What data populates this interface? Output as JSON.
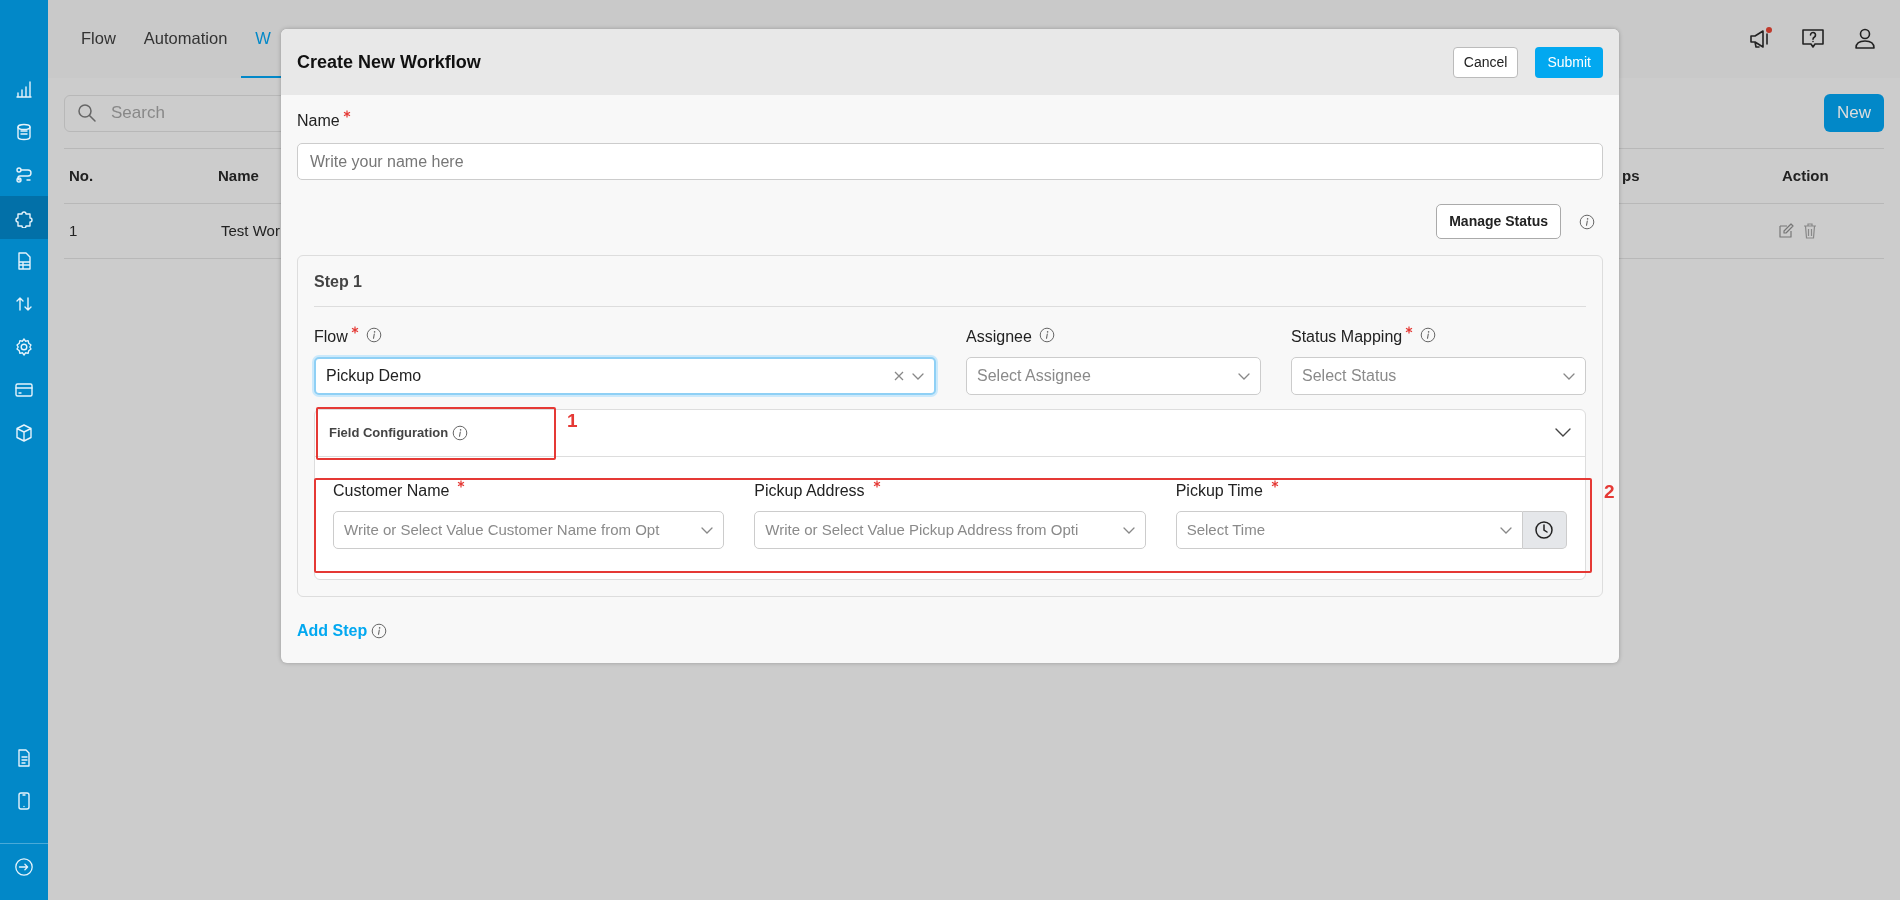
{
  "sidebar": {
    "items": [
      {
        "kind": "chart",
        "selected": false
      },
      {
        "kind": "database",
        "selected": false
      },
      {
        "kind": "route",
        "selected": false
      },
      {
        "kind": "puzzle",
        "selected": true
      },
      {
        "kind": "sheet",
        "selected": false
      },
      {
        "kind": "transfer",
        "selected": false
      },
      {
        "kind": "gear",
        "selected": false
      },
      {
        "kind": "card",
        "selected": false
      },
      {
        "kind": "box",
        "selected": false
      }
    ],
    "bottom_items": [
      {
        "kind": "document",
        "selected": false
      },
      {
        "kind": "phone",
        "selected": false
      }
    ]
  },
  "header": {
    "tabs": [
      {
        "label": "Flow",
        "selected": false
      },
      {
        "label": "Automation",
        "selected": false
      },
      {
        "label": "W",
        "selected": true
      }
    ],
    "has_notification": true
  },
  "search": {
    "placeholder": "Search"
  },
  "new_button": "New",
  "table": {
    "columns": [
      "No.",
      "Name",
      "ps",
      "Action"
    ],
    "rows": [
      {
        "cells": [
          "1",
          "Test Wor"
        ]
      }
    ]
  },
  "modal": {
    "title": "Create New Workflow",
    "buttons": [
      {
        "label": "Cancel",
        "kind": "secondary"
      },
      {
        "label": "Submit",
        "kind": "primary"
      }
    ],
    "name_field": {
      "label": "Name",
      "required": true,
      "placeholder": "Write your name here"
    },
    "manage_status": "Manage Status",
    "step": {
      "title": "Step 1",
      "fields": [
        {
          "label": "Flow",
          "required": true,
          "value": "Pickup Demo",
          "focused": true,
          "clearable": true
        },
        {
          "label": "Assignee",
          "required": false,
          "placeholder": "Select Assignee",
          "focused": false
        },
        {
          "label": "Status Mapping",
          "required": true,
          "placeholder": "Select Status",
          "focused": false
        }
      ],
      "field_configuration": {
        "title": "Field Configuration",
        "expanded": true,
        "fields": [
          {
            "label": "Customer Name",
            "required": true,
            "kind": "select",
            "placeholder": "Write or Select Value Customer Name from Opt"
          },
          {
            "label": "Pickup Address",
            "required": true,
            "kind": "select",
            "placeholder": "Write or Select Value Pickup Address from Opti"
          },
          {
            "label": "Pickup Time",
            "required": true,
            "kind": "time",
            "placeholder": "Select Time"
          }
        ]
      }
    },
    "add_step": "Add Step"
  },
  "annotations": [
    {
      "label": "1"
    },
    {
      "label": "2"
    }
  ]
}
